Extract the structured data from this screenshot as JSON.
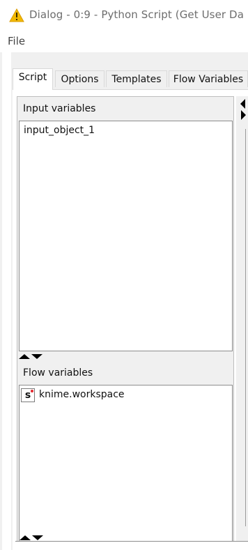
{
  "window": {
    "title": "Dialog - 0:9 - Python Script (Get User Da",
    "icon": "warning-triangle-icon"
  },
  "menu": {
    "file_label": "File"
  },
  "tabs": [
    {
      "label": "Script",
      "active": true
    },
    {
      "label": "Options",
      "active": false
    },
    {
      "label": "Templates",
      "active": false
    },
    {
      "label": "Flow Variables",
      "active": false
    }
  ],
  "input_variables": {
    "header": "Input variables",
    "items": [
      "input_object_1"
    ]
  },
  "flow_variables": {
    "header": "Flow variables",
    "items": [
      {
        "type_badge": "s",
        "name": "knime.workspace"
      }
    ]
  },
  "colors": {
    "warning_icon": "#f2b900",
    "panel_bg": "#f0f0f0",
    "string_dot": "#e3262e"
  }
}
